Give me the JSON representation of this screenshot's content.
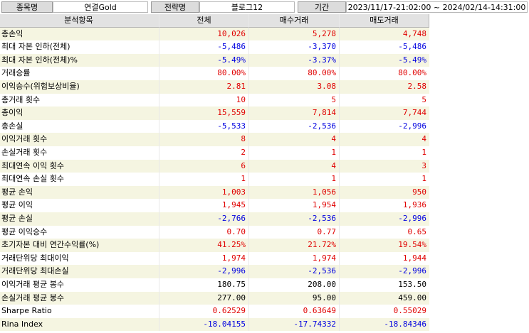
{
  "info": {
    "item_label": "종목명",
    "item_value": "연결Gold",
    "strategy_label": "전략명",
    "strategy_value": "블로그12",
    "period_label": "기간",
    "period_value": "2023/11/17-21:02:00 ~ 2024/02/14-14:31:00"
  },
  "table": {
    "headers": [
      "분석항목",
      "전체",
      "매수거래",
      "매도거래"
    ],
    "rows": [
      {
        "label": "총손익",
        "total": "10,026",
        "buy": "5,278",
        "sell": "4,748",
        "sign": [
          "pos",
          "pos",
          "pos"
        ]
      },
      {
        "label": "최대 자본 인하(전체)",
        "total": "-5,486",
        "buy": "-3,370",
        "sell": "-5,486",
        "sign": [
          "neg",
          "neg",
          "neg"
        ]
      },
      {
        "label": "최대 자본 인하(전체)%",
        "total": "-5.49%",
        "buy": "-3.37%",
        "sell": "-5.49%",
        "sign": [
          "neg",
          "neg",
          "neg"
        ]
      },
      {
        "label": "거래승률",
        "total": "80.00%",
        "buy": "80.00%",
        "sell": "80.00%",
        "sign": [
          "pos",
          "pos",
          "pos"
        ]
      },
      {
        "label": "이익승수(위험보상비율)",
        "total": "2.81",
        "buy": "3.08",
        "sell": "2.58",
        "sign": [
          "pos",
          "pos",
          "pos"
        ]
      },
      {
        "label": "총거래 횟수",
        "total": "10",
        "buy": "5",
        "sell": "5",
        "sign": [
          "pos",
          "pos",
          "pos"
        ]
      },
      {
        "label": "총이익",
        "total": "15,559",
        "buy": "7,814",
        "sell": "7,744",
        "sign": [
          "pos",
          "pos",
          "pos"
        ]
      },
      {
        "label": "총손실",
        "total": "-5,533",
        "buy": "-2,536",
        "sell": "-2,996",
        "sign": [
          "neg",
          "neg",
          "neg"
        ]
      },
      {
        "label": "이익거래 횟수",
        "total": "8",
        "buy": "4",
        "sell": "4",
        "sign": [
          "pos",
          "pos",
          "pos"
        ]
      },
      {
        "label": "손실거래 횟수",
        "total": "2",
        "buy": "1",
        "sell": "1",
        "sign": [
          "pos",
          "pos",
          "pos"
        ]
      },
      {
        "label": "최대연속 이익 횟수",
        "total": "6",
        "buy": "4",
        "sell": "3",
        "sign": [
          "pos",
          "pos",
          "pos"
        ]
      },
      {
        "label": "최대연속 손실 횟수",
        "total": "1",
        "buy": "1",
        "sell": "1",
        "sign": [
          "pos",
          "pos",
          "pos"
        ]
      },
      {
        "label": "평균 손익",
        "total": "1,003",
        "buy": "1,056",
        "sell": "950",
        "sign": [
          "pos",
          "pos",
          "pos"
        ]
      },
      {
        "label": "평균 이익",
        "total": "1,945",
        "buy": "1,954",
        "sell": "1,936",
        "sign": [
          "pos",
          "pos",
          "pos"
        ]
      },
      {
        "label": "평균 손실",
        "total": "-2,766",
        "buy": "-2,536",
        "sell": "-2,996",
        "sign": [
          "neg",
          "neg",
          "neg"
        ]
      },
      {
        "label": "평균 이익승수",
        "total": "0.70",
        "buy": "0.77",
        "sell": "0.65",
        "sign": [
          "pos",
          "pos",
          "pos"
        ]
      },
      {
        "label": "초기자본 대비 연간수익률(%)",
        "total": "41.25%",
        "buy": "21.72%",
        "sell": "19.54%",
        "sign": [
          "pos",
          "pos",
          "pos"
        ]
      },
      {
        "label": "거래단위당 최대이익",
        "total": "1,974",
        "buy": "1,974",
        "sell": "1,944",
        "sign": [
          "pos",
          "pos",
          "pos"
        ]
      },
      {
        "label": "거래단위당 최대손실",
        "total": "-2,996",
        "buy": "-2,536",
        "sell": "-2,996",
        "sign": [
          "neg",
          "neg",
          "neg"
        ]
      },
      {
        "label": "이익거래 평균 봉수",
        "total": "180.75",
        "buy": "208.00",
        "sell": "153.50",
        "sign": [
          "",
          "",
          ""
        ]
      },
      {
        "label": "손실거래 평균 봉수",
        "total": "277.00",
        "buy": "95.00",
        "sell": "459.00",
        "sign": [
          "",
          "",
          ""
        ]
      },
      {
        "label": "Sharpe Ratio",
        "total": "0.62529",
        "buy": "0.63649",
        "sell": "0.55029",
        "sign": [
          "pos",
          "pos",
          "pos"
        ]
      },
      {
        "label": "Rina Index",
        "total": "-18.04155",
        "buy": "-17.74332",
        "sell": "-18.84346",
        "sign": [
          "neg",
          "neg",
          "neg"
        ]
      }
    ]
  }
}
